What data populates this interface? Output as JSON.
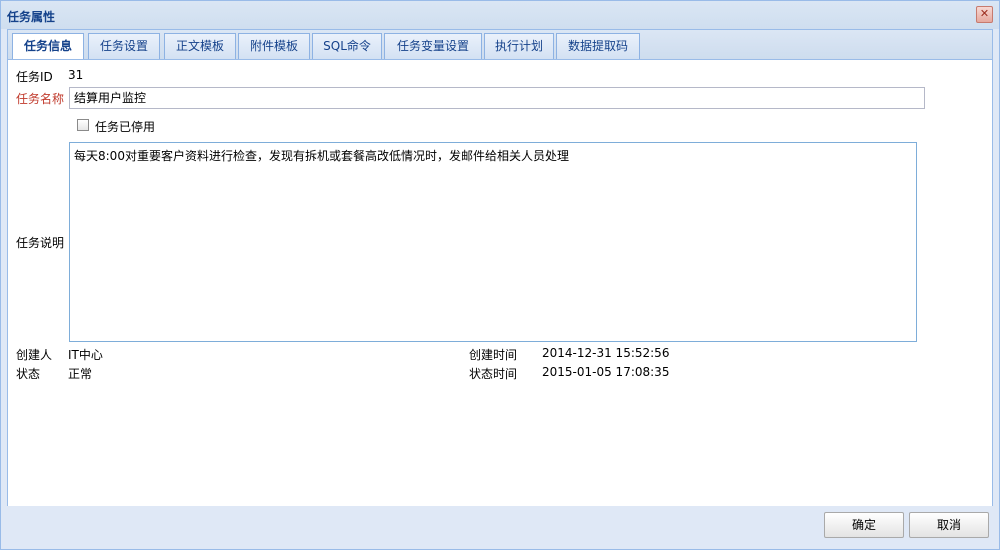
{
  "window": {
    "title": "任务属性"
  },
  "tabs": [
    {
      "label": "任务信息"
    },
    {
      "label": "任务设置"
    },
    {
      "label": "正文模板"
    },
    {
      "label": "附件模板"
    },
    {
      "label": "SQL命令"
    },
    {
      "label": "任务变量设置"
    },
    {
      "label": "执行计划"
    },
    {
      "label": "数据提取码"
    }
  ],
  "form": {
    "task_id_label": "任务ID",
    "task_id_value": "31",
    "task_name_label": "任务名称",
    "task_name_value": "结算用户监控",
    "disabled_label": "任务已停用",
    "desc_label": "任务说明",
    "desc_value": "每天8:00对重要客户资料进行检查，发现有拆机或套餐高改低情况时，发邮件给相关人员处理",
    "creator_label": "创建人",
    "creator_value": "IT中心",
    "created_time_label": "创建时间",
    "created_time_value": "2014-12-31 15:52:56",
    "status_label": "状态",
    "status_value": "正常",
    "status_time_label": "状态时间",
    "status_time_value": "2015-01-05 17:08:35"
  },
  "footer": {
    "ok_label": "确定",
    "cancel_label": "取消"
  },
  "colors": {
    "accent": "#15428b",
    "required": "#c0392b",
    "border": "#99bbe8"
  }
}
